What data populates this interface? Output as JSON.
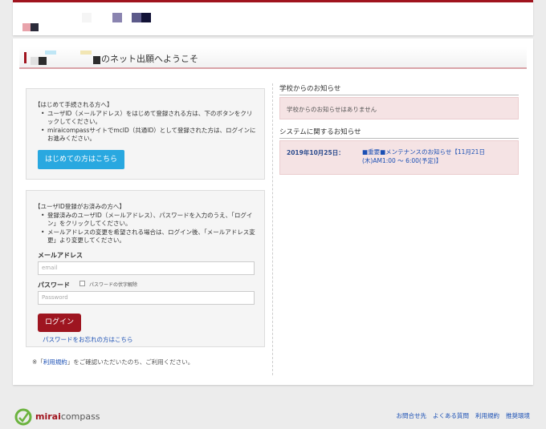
{
  "welcome": {
    "title": "のネット出願へようこそ"
  },
  "first_time": {
    "heading": "【はじめて手続される方へ】",
    "bullets": [
      "ユーザID（メールアドレス）をはじめて登録される方は、下のボタンをクリックしてください。",
      "miraicompassサイトでmcID（共通ID）として登録された方は、ログインにお進みください。"
    ],
    "button_label": "はじめての方はこちら"
  },
  "login": {
    "heading": "【ユーザID登録がお済みの方へ】",
    "bullets": [
      "登録済みのユーザID（メールアドレス）、パスワードを入力のうえ、「ログイン」をクリックしてください。",
      "メールアドレスの変更を希望される場合は、ログイン後、「メールアドレス変更」より変更してください。"
    ],
    "email_label": "メールアドレス",
    "email_placeholder": "email",
    "password_label": "パスワード",
    "show_password_label": "パスワードの伏字解除",
    "password_placeholder": "Password",
    "login_button": "ログイン",
    "forgot_link": "パスワードをお忘れの方はこちら"
  },
  "terms_note": {
    "prefix": "※「",
    "link": "利用規約",
    "suffix": "」をご確認いただいたのち、ご利用ください。"
  },
  "school_news": {
    "heading": "学校からのお知らせ",
    "empty": "学校からのお知らせはありません"
  },
  "system_news": {
    "heading": "システムに関するお知らせ",
    "date": "2019年10月25日：",
    "text": "■重要■メンテナンスのお知らせ【11月21日(木)AM1:00 ～ 6:00(予定)】"
  },
  "footer": {
    "brand_part1": "mirai",
    "brand_part2": "compass",
    "links": [
      "お問合せ先",
      "よくある質問",
      "利用規約",
      "推奨環境"
    ]
  },
  "colors": {
    "accent": "#a0141e",
    "primary_button": "#29a8e0",
    "link": "#1a4fb4",
    "notice_bg": "#f5e3e4"
  }
}
